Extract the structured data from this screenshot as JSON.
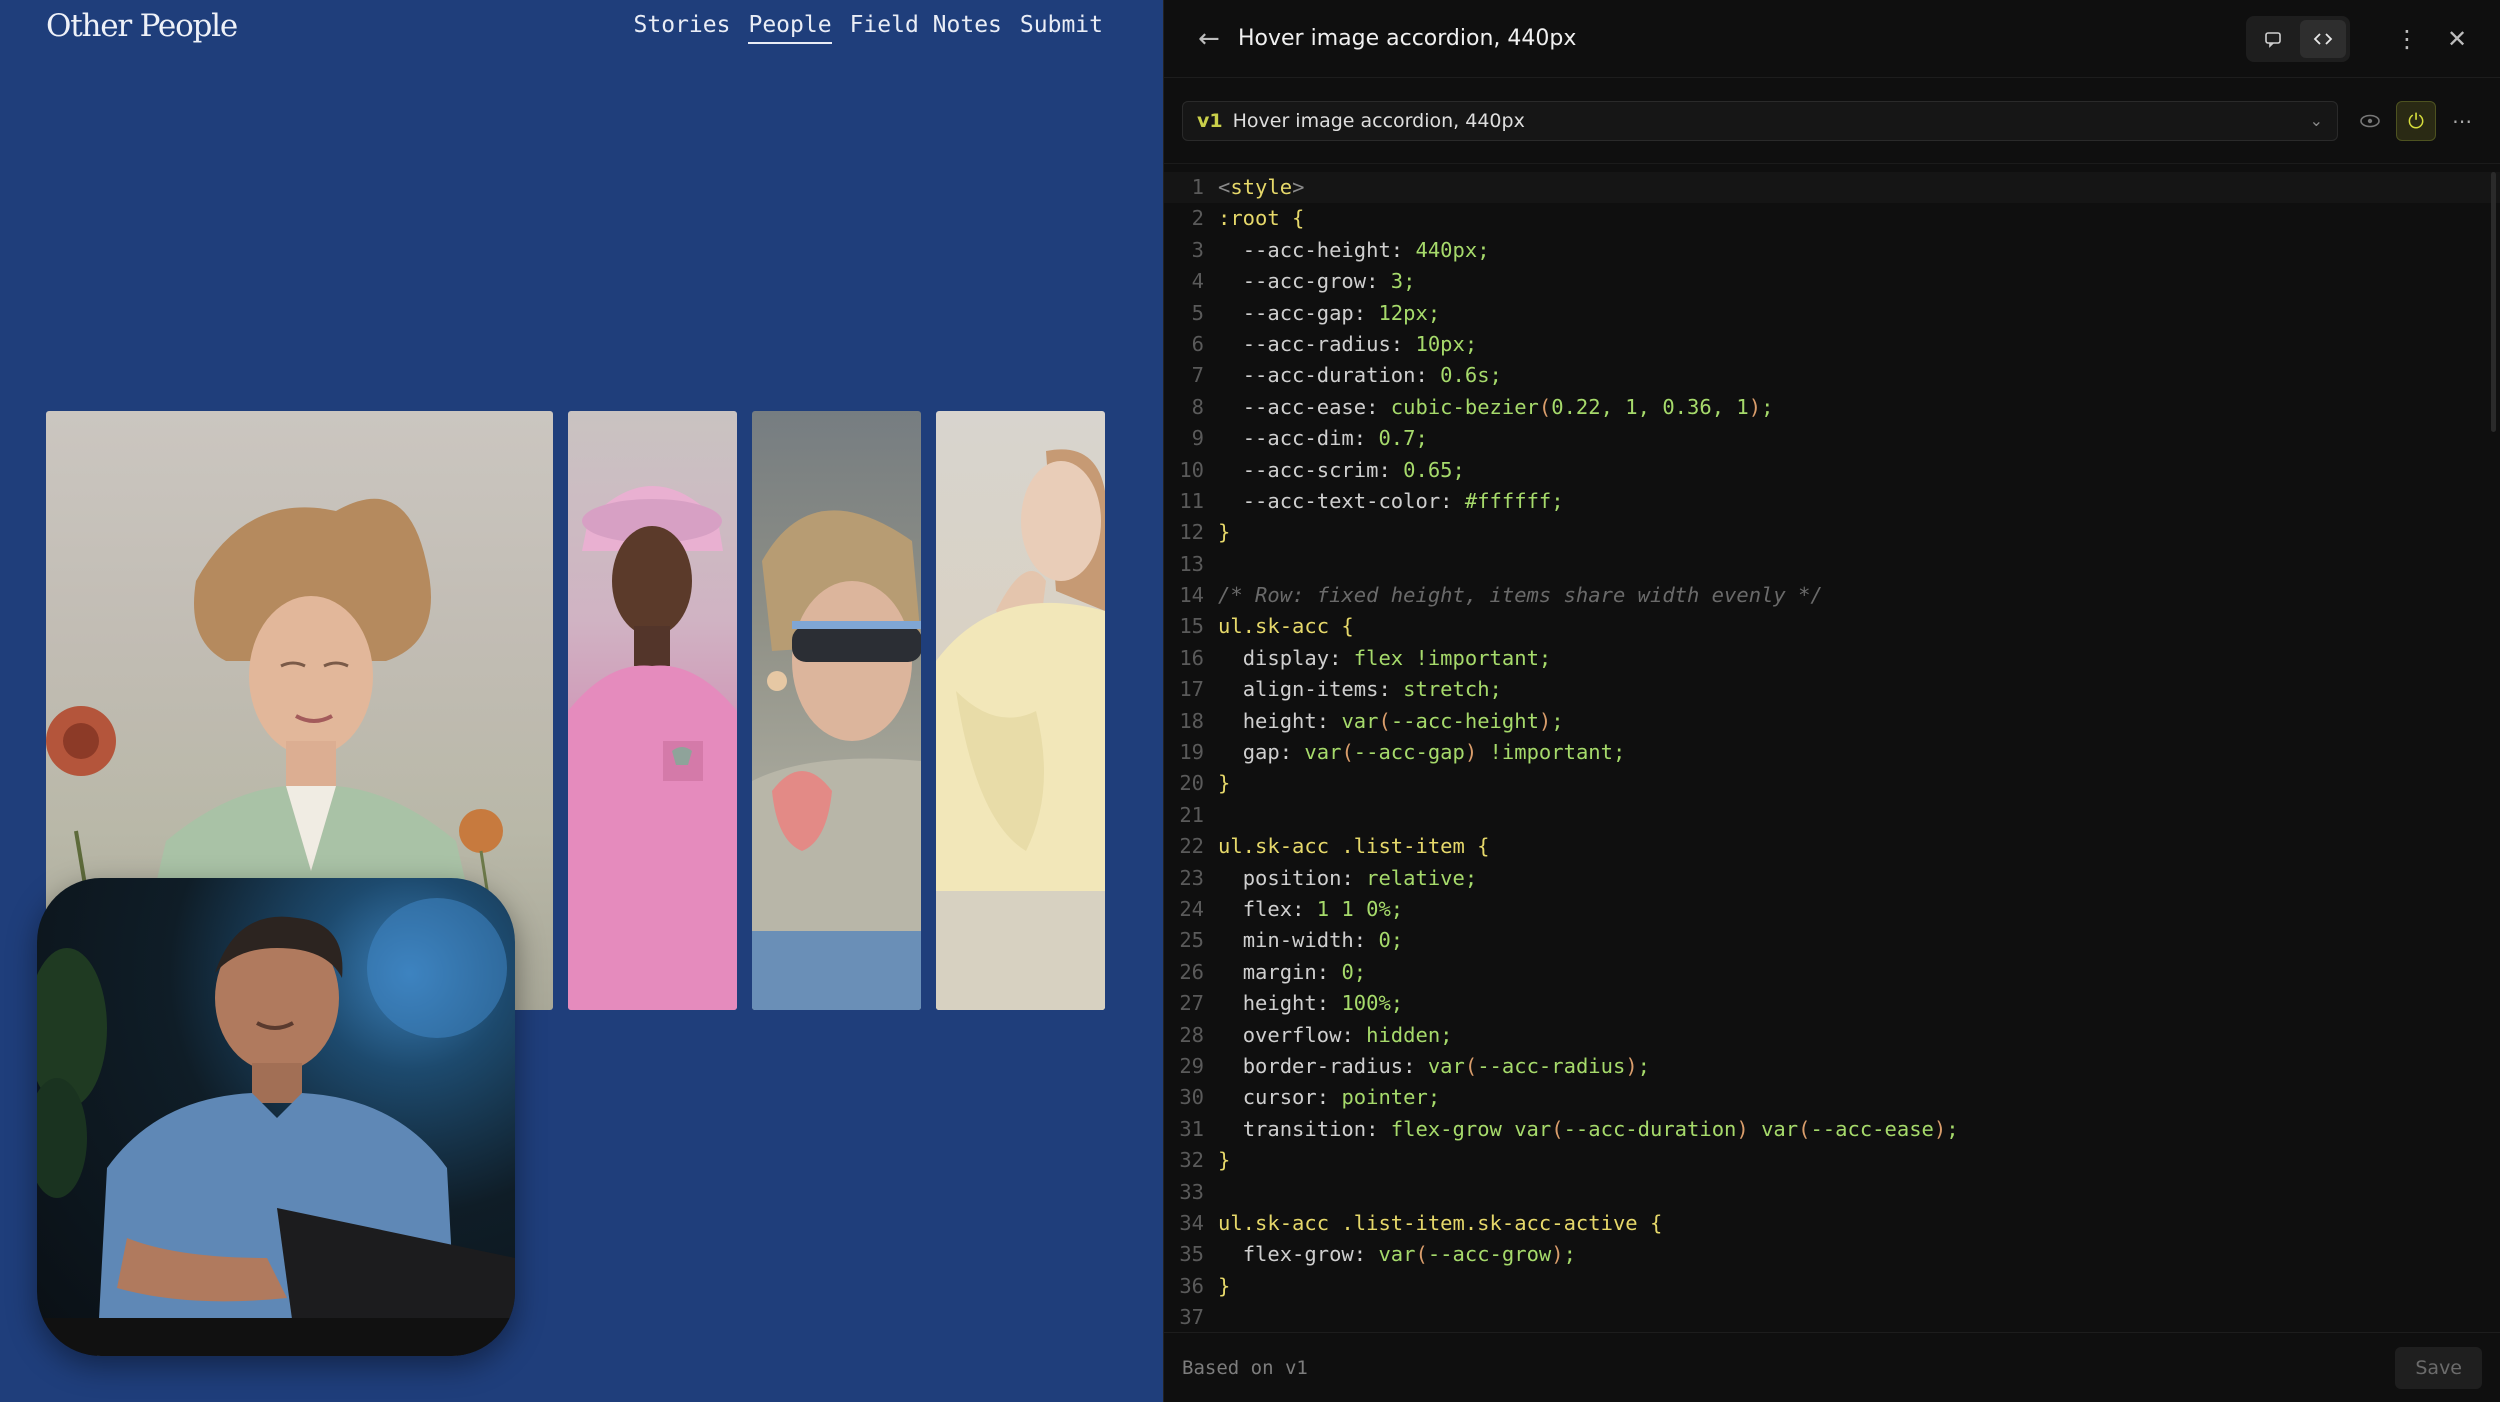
{
  "site": {
    "logo": "Other People",
    "nav": [
      "Stories",
      "People",
      "Field Notes",
      "Submit"
    ],
    "active_nav": "People",
    "accordion_images": [
      "photo-woman-green-blazer",
      "photo-man-pink-shirt",
      "photo-woman-sunglasses",
      "photo-woman-cream-sweater"
    ],
    "pip_video": "webcam-man-blue-tshirt"
  },
  "panel": {
    "title": "Hover image accordion, 440px",
    "version_badge": "v1",
    "version_name": "Hover image accordion, 440px",
    "icons": {
      "back": "arrow-left-icon",
      "preview": "chat-bubble-icon",
      "code": "code-brackets-icon",
      "more": "kebab-icon",
      "close": "close-icon",
      "eye": "eye-icon",
      "power": "power-icon"
    },
    "footer_text": "Based on v1",
    "save_label": "Save"
  },
  "code_lines": [
    "<style>",
    ":root {",
    "  --acc-height: 440px;",
    "  --acc-grow: 3;",
    "  --acc-gap: 12px;",
    "  --acc-radius: 10px;",
    "  --acc-duration: 0.6s;",
    "  --acc-ease: cubic-bezier(0.22, 1, 0.36, 1);",
    "  --acc-dim: 0.7;",
    "  --acc-scrim: 0.65;",
    "  --acc-text-color: #ffffff;",
    "}",
    "",
    "/* Row: fixed height, items share width evenly */",
    "ul.sk-acc {",
    "  display: flex !important;",
    "  align-items: stretch;",
    "  height: var(--acc-height);",
    "  gap: var(--acc-gap) !important;",
    "}",
    "",
    "ul.sk-acc .list-item {",
    "  position: relative;",
    "  flex: 1 1 0%;",
    "  min-width: 0;",
    "  margin: 0;",
    "  height: 100%;",
    "  overflow: hidden;",
    "  border-radius: var(--acc-radius);",
    "  cursor: pointer;",
    "  transition: flex-grow var(--acc-duration) var(--acc-ease);",
    "}",
    "",
    "ul.sk-acc .list-item.sk-acc-active {",
    "  flex-grow: var(--acc-grow);",
    "}",
    "",
    ""
  ],
  "colors": {
    "site_bg": "#1f3e7b",
    "panel_bg": "#0f0f0f",
    "accent": "#d7de3c"
  }
}
